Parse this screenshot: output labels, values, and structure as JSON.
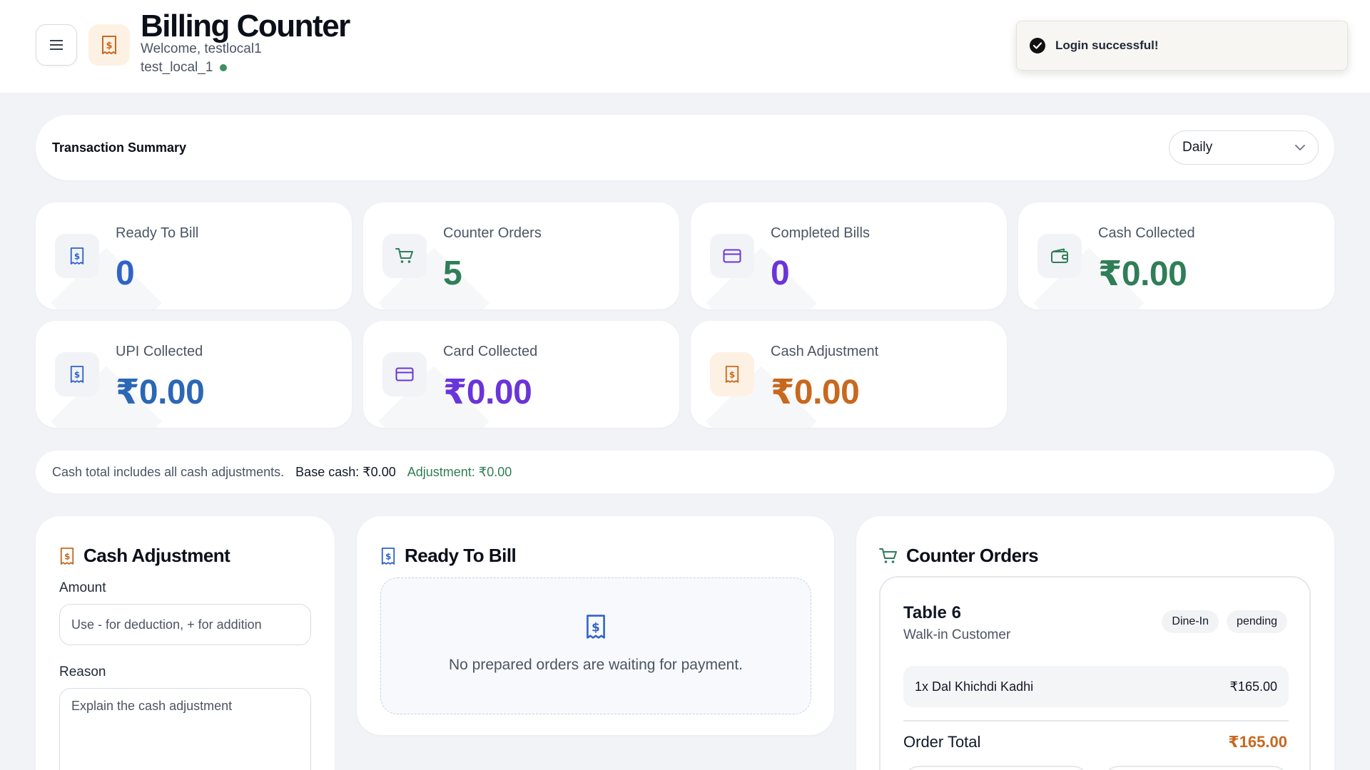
{
  "header": {
    "title": "Billing Counter",
    "welcome": "Welcome, testlocal1",
    "user_id": "test_local_1"
  },
  "toast": {
    "message": "Login successful!"
  },
  "summary": {
    "title": "Transaction Summary",
    "period": "Daily"
  },
  "stats": {
    "ready_to_bill": {
      "label": "Ready To Bill",
      "value": "0"
    },
    "counter_orders": {
      "label": "Counter Orders",
      "value": "5"
    },
    "completed_bills": {
      "label": "Completed Bills",
      "value": "0"
    },
    "cash_collected": {
      "label": "Cash Collected",
      "value": "₹0.00"
    },
    "upi_collected": {
      "label": "UPI Collected",
      "value": "₹0.00"
    },
    "card_collected": {
      "label": "Card Collected",
      "value": "₹0.00"
    },
    "cash_adjustment": {
      "label": "Cash Adjustment",
      "value": "₹0.00"
    }
  },
  "info": {
    "note": "Cash total includes all cash adjustments.",
    "base_cash": "Base cash: ₹0.00",
    "adjustment": "Adjustment: ₹0.00"
  },
  "cash_adjustment_panel": {
    "title": "Cash Adjustment",
    "amount_label": "Amount",
    "amount_placeholder": "Use - for deduction, + for addition",
    "reason_label": "Reason",
    "reason_placeholder": "Explain the cash adjustment"
  },
  "ready_panel": {
    "title": "Ready To Bill",
    "empty_text": "No prepared orders are waiting for payment."
  },
  "counter_panel": {
    "title": "Counter Orders",
    "orders": [
      {
        "table": "Table 6",
        "customer": "Walk-in Customer",
        "type": "Dine-In",
        "status": "pending",
        "items": [
          {
            "name": "1x Dal Khichdi Kadhi",
            "price": "₹165.00"
          }
        ],
        "total_label": "Order Total",
        "total": "₹165.00"
      }
    ]
  },
  "colors": {
    "blue": "#2f63c8",
    "green": "#2f7e57",
    "purple": "#6a35d8",
    "orange": "#c8681f",
    "page_bg": "#f1f3f7"
  }
}
